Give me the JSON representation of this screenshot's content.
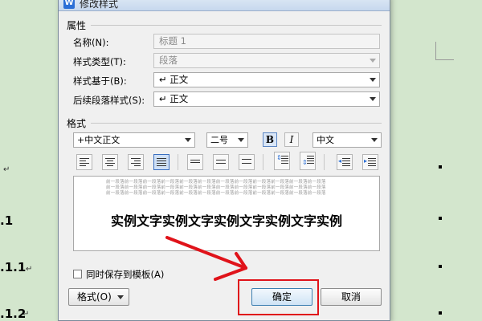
{
  "document": {
    "enter_marks": [
      "↵",
      "↵"
    ],
    "headings": [
      ".1",
      ".1.1",
      ".1.2"
    ],
    "heading_enter": "↵"
  },
  "dialog": {
    "icon": "W",
    "title": "修改样式",
    "properties_label": "属性",
    "name_label": "名称(N):",
    "name_value": "标题 1",
    "style_type_label": "样式类型(T):",
    "style_type_value": "段落",
    "based_on_label": "样式基于(B):",
    "based_on_value": "↵ 正文",
    "next_style_label": "后续段落样式(S):",
    "next_style_value": "↵ 正文",
    "format_label": "格式",
    "font_value": "+中文正文",
    "size_value": "二号",
    "bold_label": "B",
    "italic_label": "I",
    "lang_value": "中文",
    "preview_prev_para": "前一段落前一段落前一段落前一段落前一段落前一段落前一段落前一段落前一段落前一段落前一段落前一段落",
    "preview_sample": "实例文字实例文字实例文字实例文字实例",
    "save_template_label": "同时保存到模板(A)",
    "format_menu_label": "格式(O)",
    "ok_label": "确定",
    "cancel_label": "取消"
  },
  "colors": {
    "highlight_red": "#e0131a",
    "doc_background": "#d3e6cd"
  }
}
